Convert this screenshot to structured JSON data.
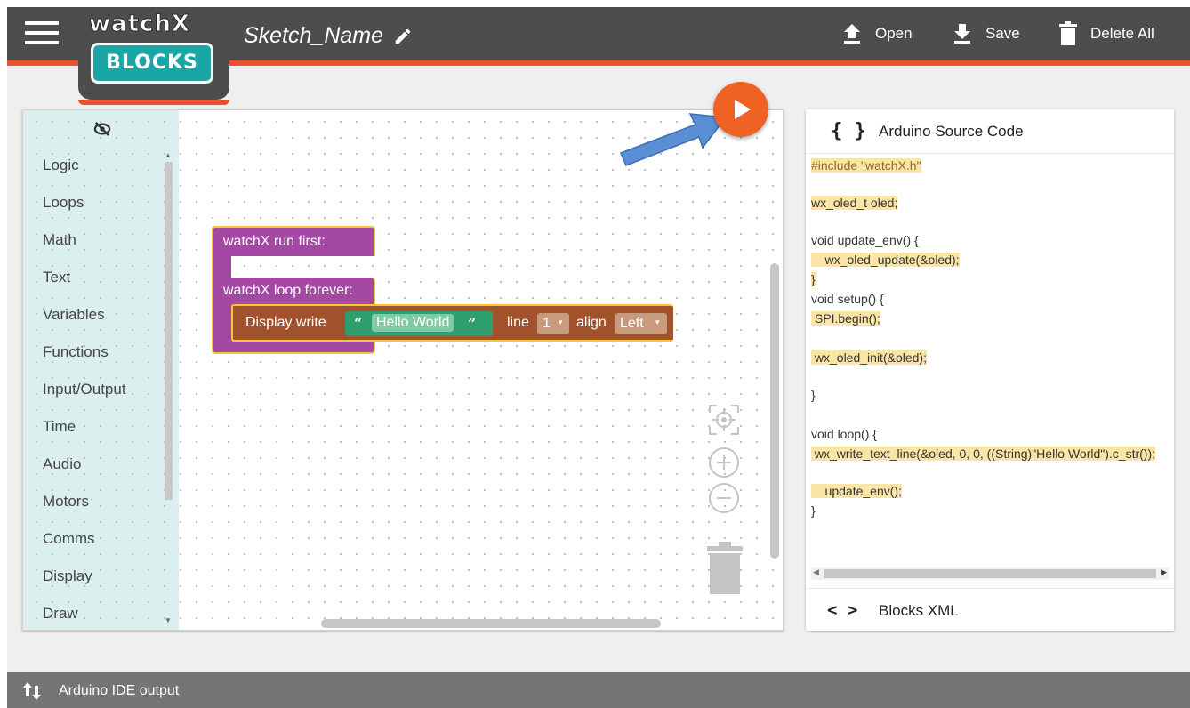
{
  "app": {
    "logo_top": "watchX",
    "logo_bottom": "BLOCKS",
    "sketch_name": "Sketch_Name"
  },
  "toolbar": {
    "open_label": "Open",
    "save_label": "Save",
    "delete_label": "Delete All"
  },
  "toolbox": {
    "categories": [
      "Logic",
      "Loops",
      "Math",
      "Text",
      "Variables",
      "Functions",
      "Input/Output",
      "Time",
      "Audio",
      "Motors",
      "Comms",
      "Display",
      "Draw"
    ]
  },
  "blocks": {
    "run_first": "watchX run first:",
    "loop_forever": "watchX loop forever:",
    "display_write": "Display write",
    "string_value": "Hello World",
    "line_label": "line",
    "line_value": "1",
    "align_label": "align",
    "align_value": "Left"
  },
  "code_panel": {
    "title": "Arduino Source Code",
    "lines": [
      "#include \"watchX.h\"",
      "",
      "wx_oled_t oled;",
      "",
      "void update_env() {",
      "    wx_oled_update(&oled);",
      "}",
      "void setup() {",
      " SPI.begin();",
      "",
      " wx_oled_init(&oled);",
      "",
      "}",
      "",
      "void loop() {",
      " wx_write_text_line(&oled, 0, 0, ((String)\"Hello World\").c_str());",
      "",
      "    update_env();",
      "}"
    ]
  },
  "xml_panel": {
    "title": "Blocks XML"
  },
  "bottom": {
    "label": "Arduino IDE output"
  },
  "colors": {
    "topbar": "#4d4d4d",
    "accent": "#e8522b",
    "play": "#f06124",
    "logo_teal": "#1ba6a6",
    "block_purple": "#a349a4",
    "block_brown": "#a0522d",
    "block_green": "#2e9e6e",
    "toolbox_bg": "#dcefef"
  }
}
